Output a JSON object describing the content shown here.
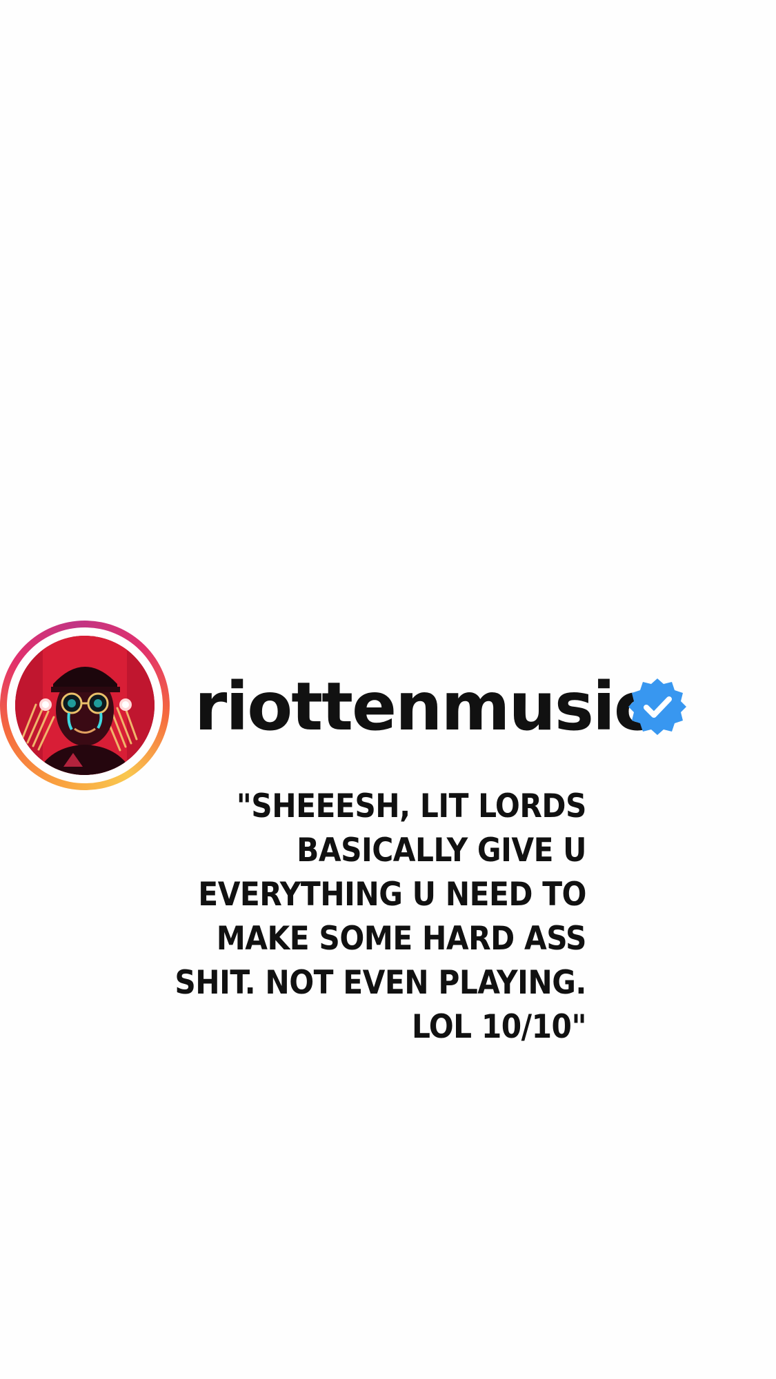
{
  "profile": {
    "username": "riottenmusic",
    "verified_icon": "verified-badge-icon",
    "accent_ring_colors": [
      "#f9a03f",
      "#e1306c",
      "#c13584"
    ],
    "badge_color": "#3897f0"
  },
  "testimonial": {
    "quote": "\"SHEEESH, LIT LORDS BASICALLY GIVE U EVERYTHING U NEED TO MAKE SOME HARD ASS SHIT. NOT EVEN PLAYING. LOL 10/10\""
  }
}
